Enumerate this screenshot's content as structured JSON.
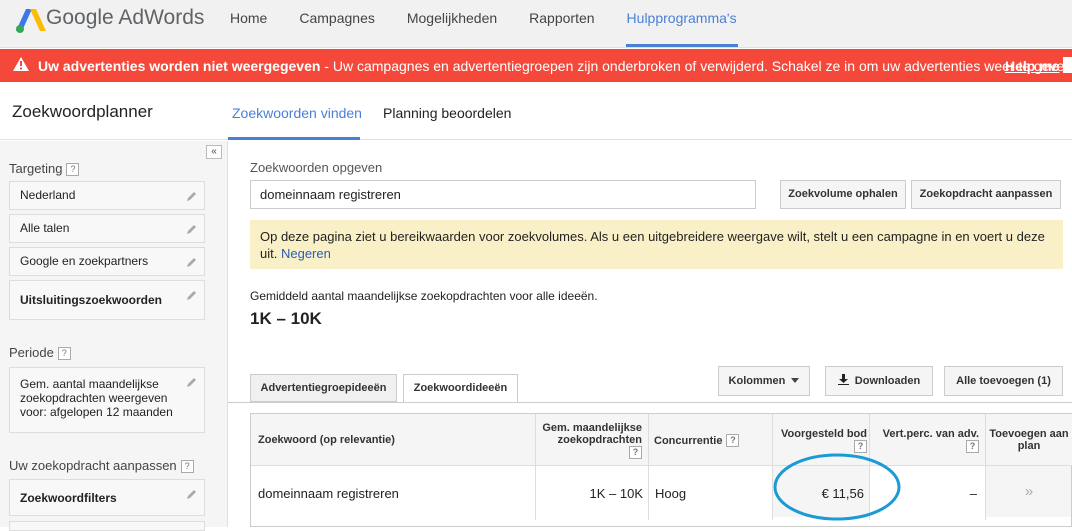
{
  "app": {
    "brand": "Google AdWords"
  },
  "nav": {
    "items": [
      "Home",
      "Campagnes",
      "Mogelijkheden",
      "Rapporten",
      "Hulpprogramma's"
    ],
    "active_index": 4
  },
  "alert": {
    "bold_text": "Uw advertenties worden niet weergegeven",
    "text": " - Uw campagnes en advertentiegroepen zijn onderbroken of verwijderd. Schakel ze in om uw advertenties weer te geven.",
    "help_link": "Help me",
    "color": "#f4493a"
  },
  "header": {
    "title": "Zoekwoordplanner",
    "tabs": [
      "Zoekwoorden vinden",
      "Planning beoordelen"
    ],
    "active_tab": 0
  },
  "sidebar": {
    "collapse_glyph": "«",
    "targeting_label": "Targeting",
    "targeting_items": [
      "Nederland",
      "Alle talen",
      "Google en zoekpartners",
      "Uitsluitingszoekwoorden"
    ],
    "period_label": "Periode",
    "period_text": "Gem. aantal maandelijkse zoekopdrachten weergeven voor: afgelopen 12 maanden",
    "adjust_label": "Uw zoekopdracht aanpassen",
    "adjust_item": "Zoekwoordfilters",
    "help_mark": "?"
  },
  "main": {
    "input_label": "Zoekwoorden opgeven",
    "input_value": "domeinnaam registreren",
    "get_volume_button": "Zoekvolume ophalen",
    "adjust_query_button": "Zoekopdracht aanpassen",
    "notice_text": "Op deze pagina ziet u bereikwaarden voor zoekvolumes. Als u een uitgebreidere weergave wilt, stelt u een campagne in en voert u deze uit. ",
    "notice_link": "Negeren",
    "avg_label": "Gemiddeld aantal maandelijkse zoekopdrachten voor alle ideeën.",
    "avg_value": "1K – 10K",
    "subtabs": [
      "Advertentiegroepideeën",
      "Zoekwoordideeën"
    ],
    "active_subtab": 1,
    "columns_button": "Kolommen",
    "download_button": "Downloaden",
    "add_all_button": "Alle toevoegen (1)"
  },
  "table": {
    "headers": {
      "keyword": "Zoekwoord (op relevantie)",
      "avg_searches": "Gem. maandelijkse zoekopdrachten",
      "competition": "Concurrentie",
      "bid": "Voorgesteld bod",
      "impr_share": "Vert.perc. van adv.",
      "add": "Toevoegen aan plan"
    },
    "rows": [
      {
        "keyword": "domeinnaam registreren",
        "avg_searches": "1K – 10K",
        "competition": "Hoog",
        "bid": "€ 11,56",
        "impr_share": "–",
        "add": "»"
      }
    ]
  },
  "highlight_color": "#1b9ad6"
}
